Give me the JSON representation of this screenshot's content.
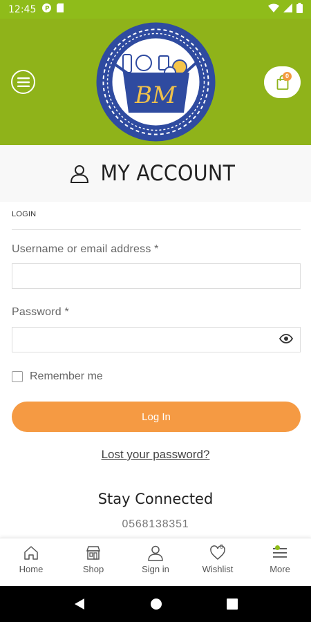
{
  "status_bar": {
    "time": "12:45"
  },
  "header": {
    "logo_text": "BM",
    "cart_count": "0"
  },
  "page": {
    "title": "MY ACCOUNT"
  },
  "login_form": {
    "section_label": "LOGIN",
    "username_label": "Username or email address *",
    "username_value": "",
    "password_label": "Password *",
    "password_value": "",
    "remember_label": "Remember me",
    "login_button": "Log In",
    "lost_password": "Lost your password?"
  },
  "contact": {
    "heading": "Stay Connected",
    "phone": "0568138351"
  },
  "bottom_nav": {
    "items": [
      {
        "label": "Home",
        "icon": "home-icon"
      },
      {
        "label": "Shop",
        "icon": "shop-icon"
      },
      {
        "label": "Sign in",
        "icon": "user-icon"
      },
      {
        "label": "Wishlist",
        "icon": "heart-icon",
        "badge": "0"
      },
      {
        "label": "More",
        "icon": "menu-icon"
      }
    ]
  },
  "colors": {
    "header_green": "#8fb31a",
    "accent_orange": "#f59a43",
    "logo_blue": "#2f4ba0"
  }
}
